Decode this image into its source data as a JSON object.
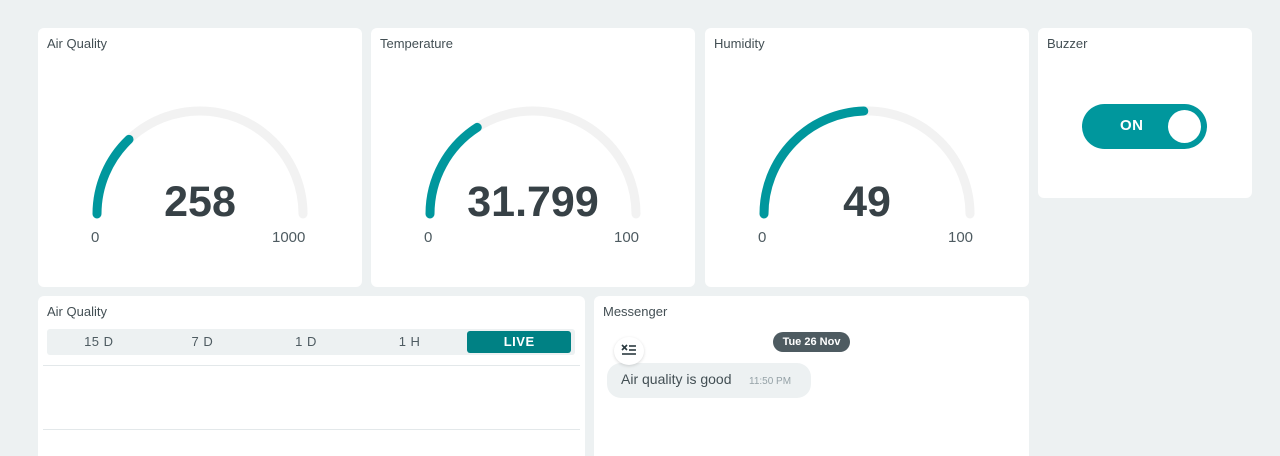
{
  "widgets": {
    "air_quality_gauge": {
      "title": "Air Quality",
      "value": "258",
      "min": "0",
      "max": "1000",
      "fraction": 0.258
    },
    "temperature_gauge": {
      "title": "Temperature",
      "value": "31.799",
      "min": "0",
      "max": "100",
      "fraction": 0.318
    },
    "humidity_gauge": {
      "title": "Humidity",
      "value": "49",
      "min": "0",
      "max": "100",
      "fraction": 0.49
    },
    "buzzer": {
      "title": "Buzzer",
      "state_label": "ON",
      "state": true
    },
    "air_quality_chart": {
      "title": "Air Quality",
      "ranges": [
        "15 D",
        "7 D",
        "1 D",
        "1 H",
        "LIVE"
      ],
      "selected_range": "LIVE"
    },
    "messenger": {
      "title": "Messenger",
      "date": "Tue 26 Nov",
      "messages": [
        {
          "text": "Air quality is good",
          "time": "11:50 PM"
        }
      ]
    }
  },
  "colors": {
    "accent": "#00979d",
    "active_tab": "#008184",
    "track": "#f2f2f2",
    "background": "#edf1f2"
  },
  "icons": {
    "clear_chat": "clear-messages-icon"
  }
}
